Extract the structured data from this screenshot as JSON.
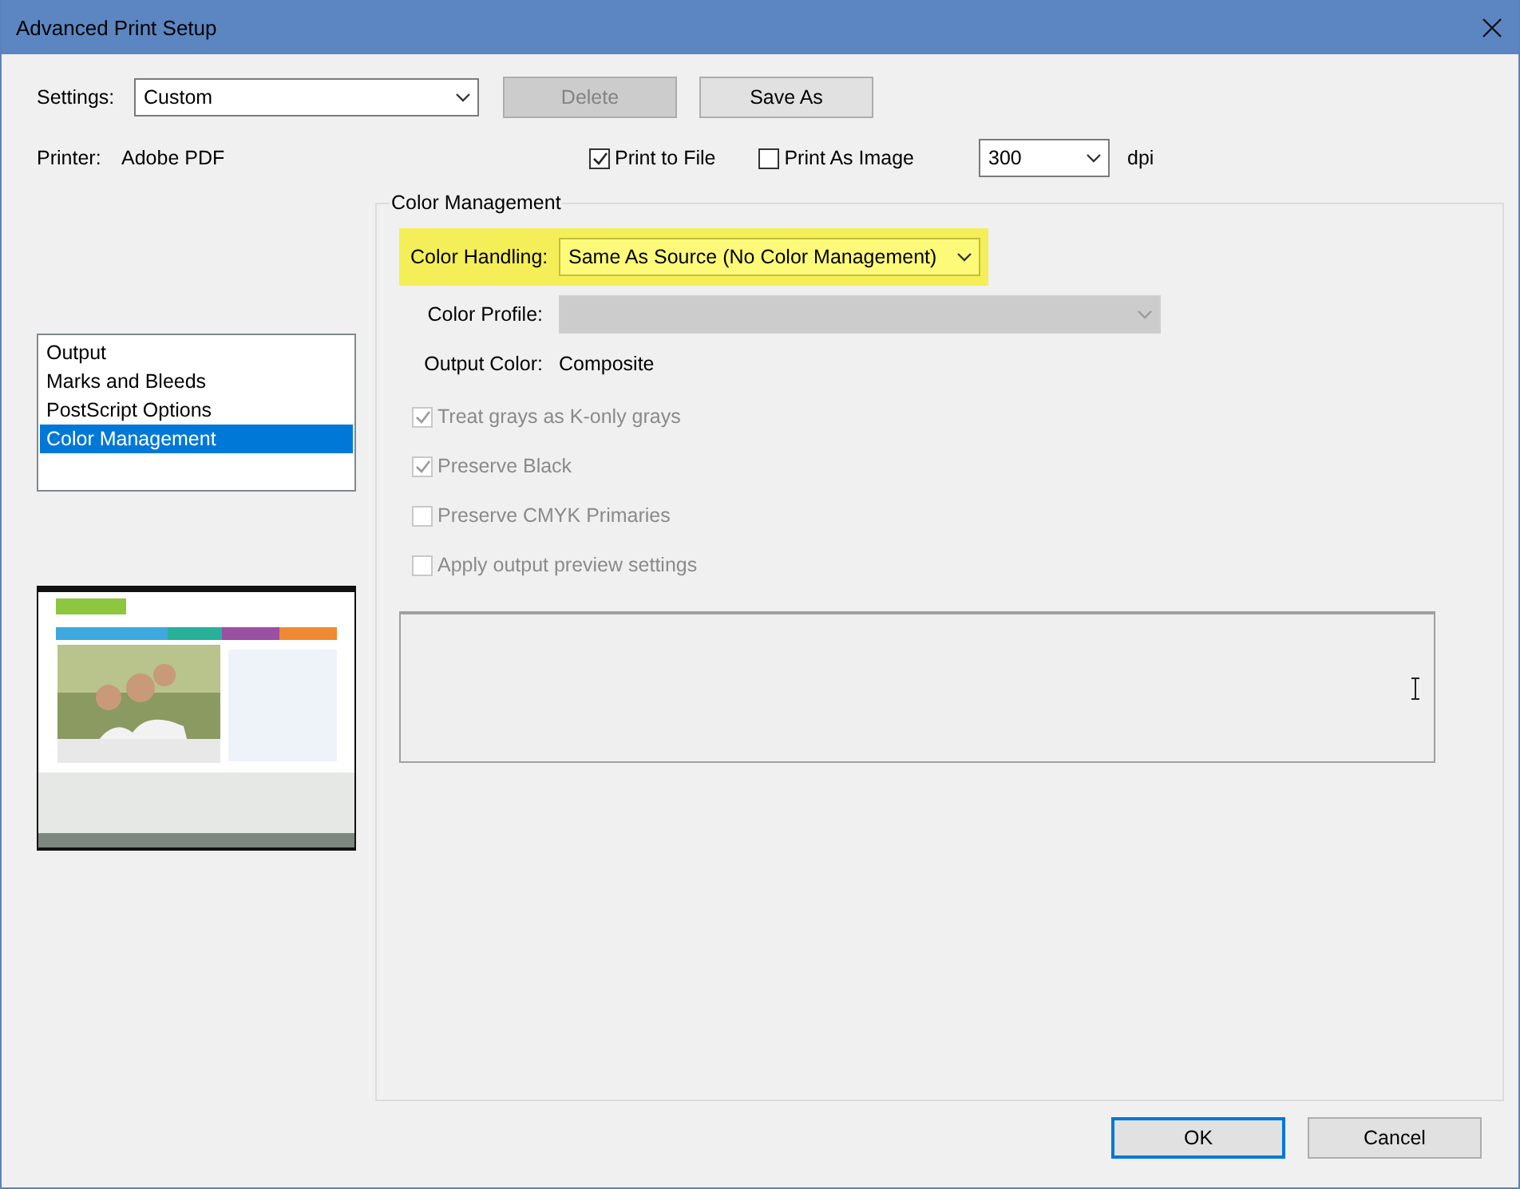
{
  "window": {
    "title": "Advanced Print Setup"
  },
  "settings": {
    "label": "Settings:",
    "value": "Custom"
  },
  "setting_buttons": [
    {
      "label": "Delete",
      "disabled": true
    },
    {
      "label": "Save As",
      "disabled": false
    }
  ],
  "printer": {
    "label": "Printer:",
    "value": "Adobe PDF"
  },
  "print_options": [
    {
      "label": "Print to File",
      "checked": true
    },
    {
      "label": "Print As Image",
      "checked": false
    }
  ],
  "resolution": {
    "value": "300",
    "unit": "dpi"
  },
  "sidebar": {
    "items": [
      {
        "label": "Output",
        "selected": false
      },
      {
        "label": "Marks and Bleeds",
        "selected": false
      },
      {
        "label": "PostScript Options",
        "selected": false
      },
      {
        "label": "Color Management",
        "selected": true
      }
    ]
  },
  "color_management": {
    "title": "Color Management",
    "color_handling": {
      "label": "Color Handling:",
      "value": "Same As Source (No Color Management)",
      "highlighted": true
    },
    "color_profile": {
      "label": "Color Profile:",
      "disabled": true
    },
    "output_color": {
      "label": "Output Color:",
      "value": "Composite"
    },
    "options": [
      {
        "label": "Treat grays as K-only grays",
        "checked": true,
        "disabled": true
      },
      {
        "label": "Preserve Black",
        "checked": true,
        "disabled": true
      },
      {
        "label": "Preserve CMYK Primaries",
        "checked": false,
        "disabled": true
      },
      {
        "label": "Apply output preview settings",
        "checked": false,
        "disabled": true
      }
    ]
  },
  "footer_buttons": [
    {
      "label": "OK",
      "default": true
    },
    {
      "label": "Cancel",
      "default": false
    }
  ]
}
